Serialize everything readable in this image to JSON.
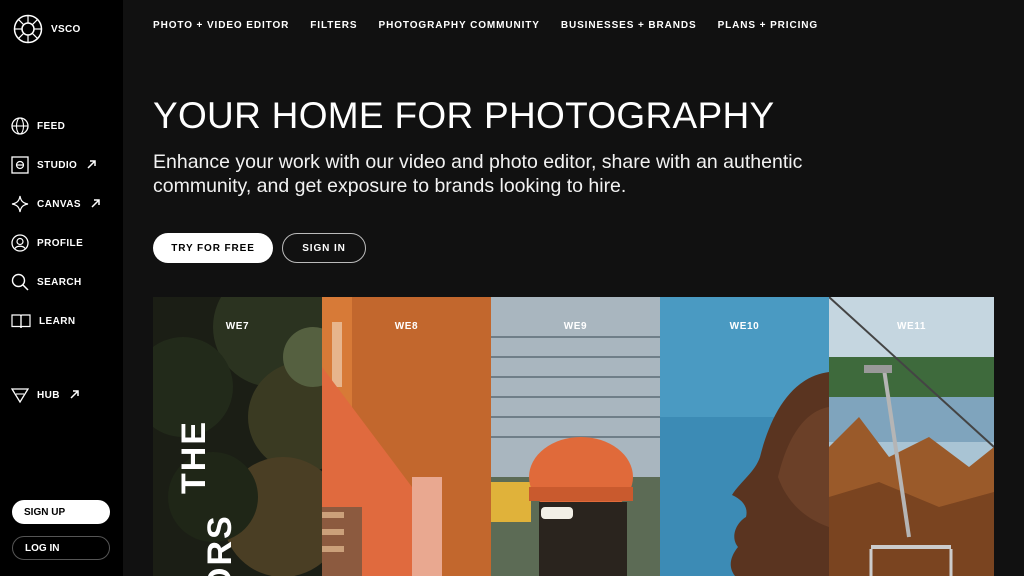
{
  "brand": {
    "name": "VSCO"
  },
  "sidebar": {
    "items": [
      {
        "label": "FEED",
        "icon": "globe-icon",
        "external": false
      },
      {
        "label": "STUDIO",
        "icon": "studio-icon",
        "external": true
      },
      {
        "label": "CANVAS",
        "icon": "sparkle-icon",
        "external": true
      },
      {
        "label": "PROFILE",
        "icon": "profile-icon",
        "external": false
      },
      {
        "label": "SEARCH",
        "icon": "search-icon",
        "external": false
      },
      {
        "label": "LEARN",
        "icon": "book-icon",
        "external": false
      },
      {
        "label": "HUB",
        "icon": "triangle-icon",
        "external": true
      }
    ],
    "signup_label": "SIGN UP",
    "login_label": "LOG IN"
  },
  "topnav": {
    "links": [
      "PHOTO + VIDEO EDITOR",
      "FILTERS",
      "PHOTOGRAPHY COMMUNITY",
      "BUSINESSES + BRANDS",
      "PLANS + PRICING"
    ]
  },
  "hero": {
    "headline": "YOUR HOME FOR PHOTOGRAPHY",
    "subhead": "Enhance your work with our video and photo editor, share with an authentic community, and get exposure to brands looking to hire.",
    "cta_primary": "TRY FOR FREE",
    "cta_secondary": "SIGN IN"
  },
  "gallery": {
    "panels": [
      {
        "label": "WE7",
        "overlay_text": [
          "THE",
          "ORS"
        ]
      },
      {
        "label": "WE8"
      },
      {
        "label": "WE9"
      },
      {
        "label": "WE10"
      },
      {
        "label": "WE11"
      }
    ]
  },
  "colors": {
    "sidebar_bg": "#000000",
    "main_bg": "#111111",
    "accent": "#ffffff"
  }
}
